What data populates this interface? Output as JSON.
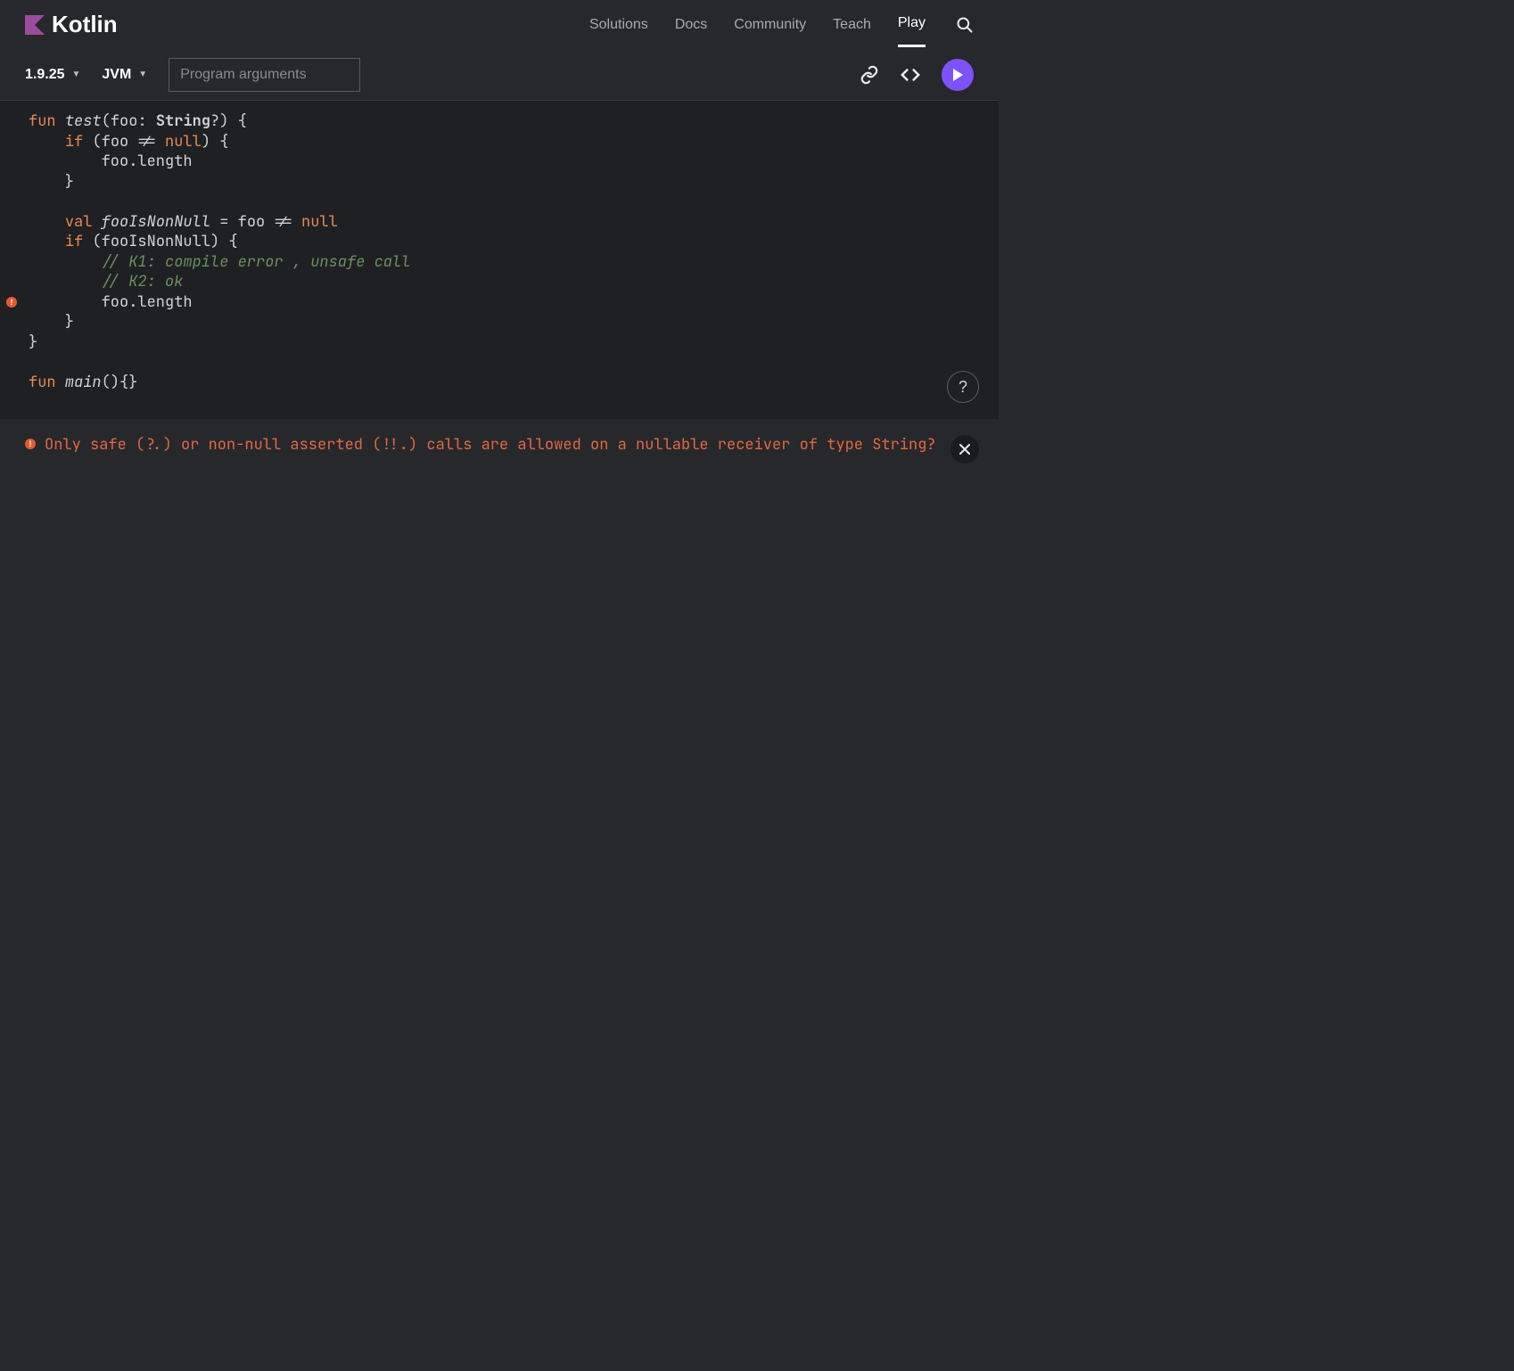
{
  "brand": "Kotlin",
  "nav": {
    "items": [
      "Solutions",
      "Docs",
      "Community",
      "Teach",
      "Play"
    ],
    "active": "Play"
  },
  "toolbar": {
    "version": "1.9.25",
    "target": "JVM",
    "args_placeholder": "Program arguments"
  },
  "help_label": "?",
  "editor": {
    "error_line": 10,
    "code_tokens": [
      [
        [
          "kw",
          "fun"
        ],
        [
          "",
          " "
        ],
        [
          "fn",
          "test"
        ],
        [
          "",
          "("
        ],
        [
          "",
          "foo"
        ],
        [
          "",
          ": "
        ],
        [
          "ty",
          "String"
        ],
        [
          "",
          "?) {"
        ]
      ],
      [
        [
          "",
          "    "
        ],
        [
          "kw",
          "if"
        ],
        [
          "",
          " (foo != "
        ],
        [
          "nl",
          "null"
        ],
        [
          "",
          ") {"
        ]
      ],
      [
        [
          "",
          "        foo.length"
        ]
      ],
      [
        [
          "",
          "    }"
        ]
      ],
      [
        [
          "",
          ""
        ]
      ],
      [
        [
          "",
          "    "
        ],
        [
          "kw",
          "val"
        ],
        [
          "",
          " "
        ],
        [
          "fn",
          "fooIsNonNull"
        ],
        [
          "",
          " = foo != "
        ],
        [
          "nl",
          "null"
        ]
      ],
      [
        [
          "",
          "    "
        ],
        [
          "kw",
          "if"
        ],
        [
          "",
          " (fooIsNonNull) {"
        ]
      ],
      [
        [
          "",
          "        "
        ],
        [
          "cm",
          "// K1: compile error , unsafe call"
        ]
      ],
      [
        [
          "",
          "        "
        ],
        [
          "cm",
          "// K2: ok"
        ]
      ],
      [
        [
          "",
          "        foo.length"
        ]
      ],
      [
        [
          "",
          "    }"
        ]
      ],
      [
        [
          "",
          "}"
        ]
      ],
      [
        [
          "",
          ""
        ]
      ],
      [
        [
          "kw",
          "fun"
        ],
        [
          "",
          " "
        ],
        [
          "fn",
          "main"
        ],
        [
          "",
          "(){}"
        ]
      ]
    ]
  },
  "console": {
    "error": "Only safe (?.) or non-null asserted (!!.) calls are allowed on a nullable receiver of type String?"
  }
}
